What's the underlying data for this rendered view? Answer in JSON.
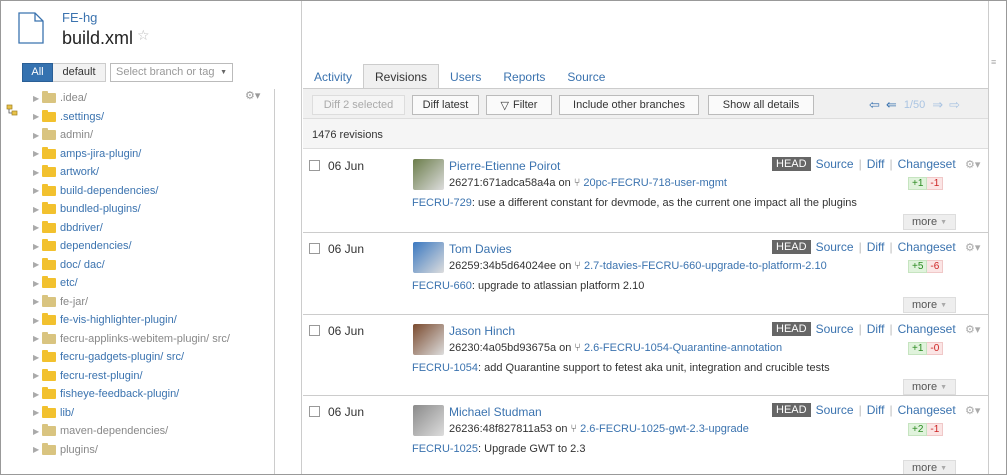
{
  "header": {
    "repo": "FE-hg",
    "file": "build.xml",
    "star": "☆"
  },
  "branch_bar": {
    "all": "All",
    "default": "default",
    "placeholder": "Select branch or tag"
  },
  "tree": {
    "items": [
      {
        "name": ".idea/",
        "muted": true
      },
      {
        "name": ".settings/",
        "muted": false
      },
      {
        "name": "admin/",
        "muted": true
      },
      {
        "name": "amps-jira-plugin/",
        "muted": false
      },
      {
        "name": "artwork/",
        "muted": false
      },
      {
        "name": "build-dependencies/",
        "muted": false
      },
      {
        "name": "bundled-plugins/",
        "muted": false
      },
      {
        "name": "dbdriver/",
        "muted": false
      },
      {
        "name": "dependencies/",
        "muted": false
      },
      {
        "name": "doc/ dac/",
        "muted": false
      },
      {
        "name": "etc/",
        "muted": false
      },
      {
        "name": "fe-jar/",
        "muted": true
      },
      {
        "name": "fe-vis-highlighter-plugin/",
        "muted": false
      },
      {
        "name": "fecru-applinks-webitem-plugin/ src/",
        "muted": true
      },
      {
        "name": "fecru-gadgets-plugin/ src/",
        "muted": false
      },
      {
        "name": "fecru-rest-plugin/",
        "muted": false
      },
      {
        "name": "fisheye-feedback-plugin/",
        "muted": false
      },
      {
        "name": "lib/",
        "muted": false
      },
      {
        "name": "maven-dependencies/",
        "muted": true
      },
      {
        "name": "plugins/",
        "muted": true
      }
    ]
  },
  "tabs": [
    "Activity",
    "Revisions",
    "Users",
    "Reports",
    "Source"
  ],
  "active_tab": "Revisions",
  "toolbar": {
    "diff_selected": "Diff 2 selected",
    "diff_latest": "Diff latest",
    "filter": "Filter",
    "include_branches": "Include other branches",
    "show_details": "Show all details",
    "page": "1/50"
  },
  "revision_count": "1476 revisions",
  "revisions": [
    {
      "date": "06 Jun",
      "author": "Pierre-Etienne Poirot",
      "hash": "26271:671adca58a4a on",
      "branch": "20pc-FECRU-718-user-mgmt",
      "issue": "FECRU-729",
      "message": ": use a different constant for devmode, as the current one impact all the plugins",
      "plus": "+1",
      "minus": "-1",
      "avatar_color": "#6b7d4a"
    },
    {
      "date": "06 Jun",
      "author": "Tom Davies",
      "hash": "26259:34b5d64024ee on",
      "branch": "2.7-tdavies-FECRU-660-upgrade-to-platform-2.10",
      "issue": "FECRU-660",
      "message": ": upgrade to atlassian platform 2.10",
      "plus": "+5",
      "minus": "-6",
      "avatar_color": "#3a78c0"
    },
    {
      "date": "06 Jun",
      "author": "Jason Hinch",
      "hash": "26230:4a05bd93675a on",
      "branch": "2.6-FECRU-1054-Quarantine-annotation",
      "issue": "FECRU-1054",
      "message": ": add Quarantine support to fetest aka unit, integration and crucible tests",
      "plus": "+1",
      "minus": "-0",
      "avatar_color": "#7a4a2e"
    },
    {
      "date": "06 Jun",
      "author": "Michael Studman",
      "hash": "26236:48f827811a53 on",
      "branch": "2.6-FECRU-1025-gwt-2.3-upgrade",
      "issue": "FECRU-1025",
      "message": ": Upgrade GWT to 2.3",
      "plus": "+2",
      "minus": "-1",
      "avatar_color": "#8a8a8a"
    }
  ],
  "labels": {
    "head": "HEAD",
    "source": "Source",
    "diff": "Diff",
    "changeset": "Changeset",
    "more": "more"
  }
}
